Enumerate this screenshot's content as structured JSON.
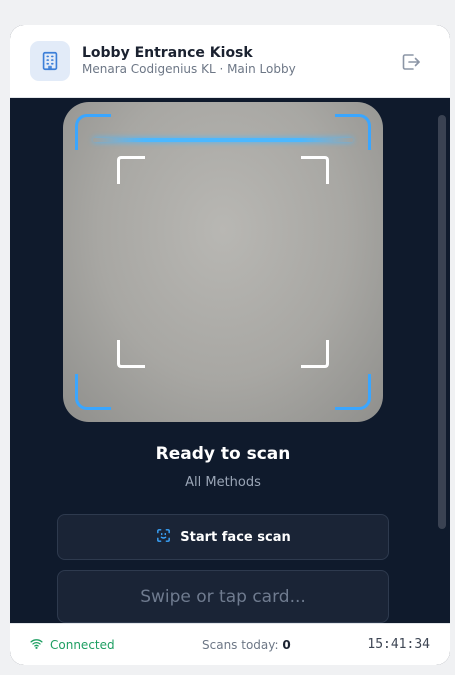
{
  "header": {
    "title": "Lobby Entrance Kiosk",
    "subtitle": "Menara Codigenius KL · Main Lobby",
    "logo_icon": "building-icon",
    "logout_icon": "logout-icon"
  },
  "scanner": {
    "status": "Ready to scan",
    "method": "All Methods",
    "frame_color": "#3aa6ff"
  },
  "actions": {
    "face_scan_label": "Start face scan",
    "face_scan_icon": "face-scan-icon",
    "card_placeholder": "Swipe or tap card..."
  },
  "footer": {
    "connection_label": "Connected",
    "connection_icon": "wifi-icon",
    "connection_color": "#1e9e62",
    "scans_label": "Scans today:",
    "scans_count": "0",
    "time": "15:41:34"
  }
}
